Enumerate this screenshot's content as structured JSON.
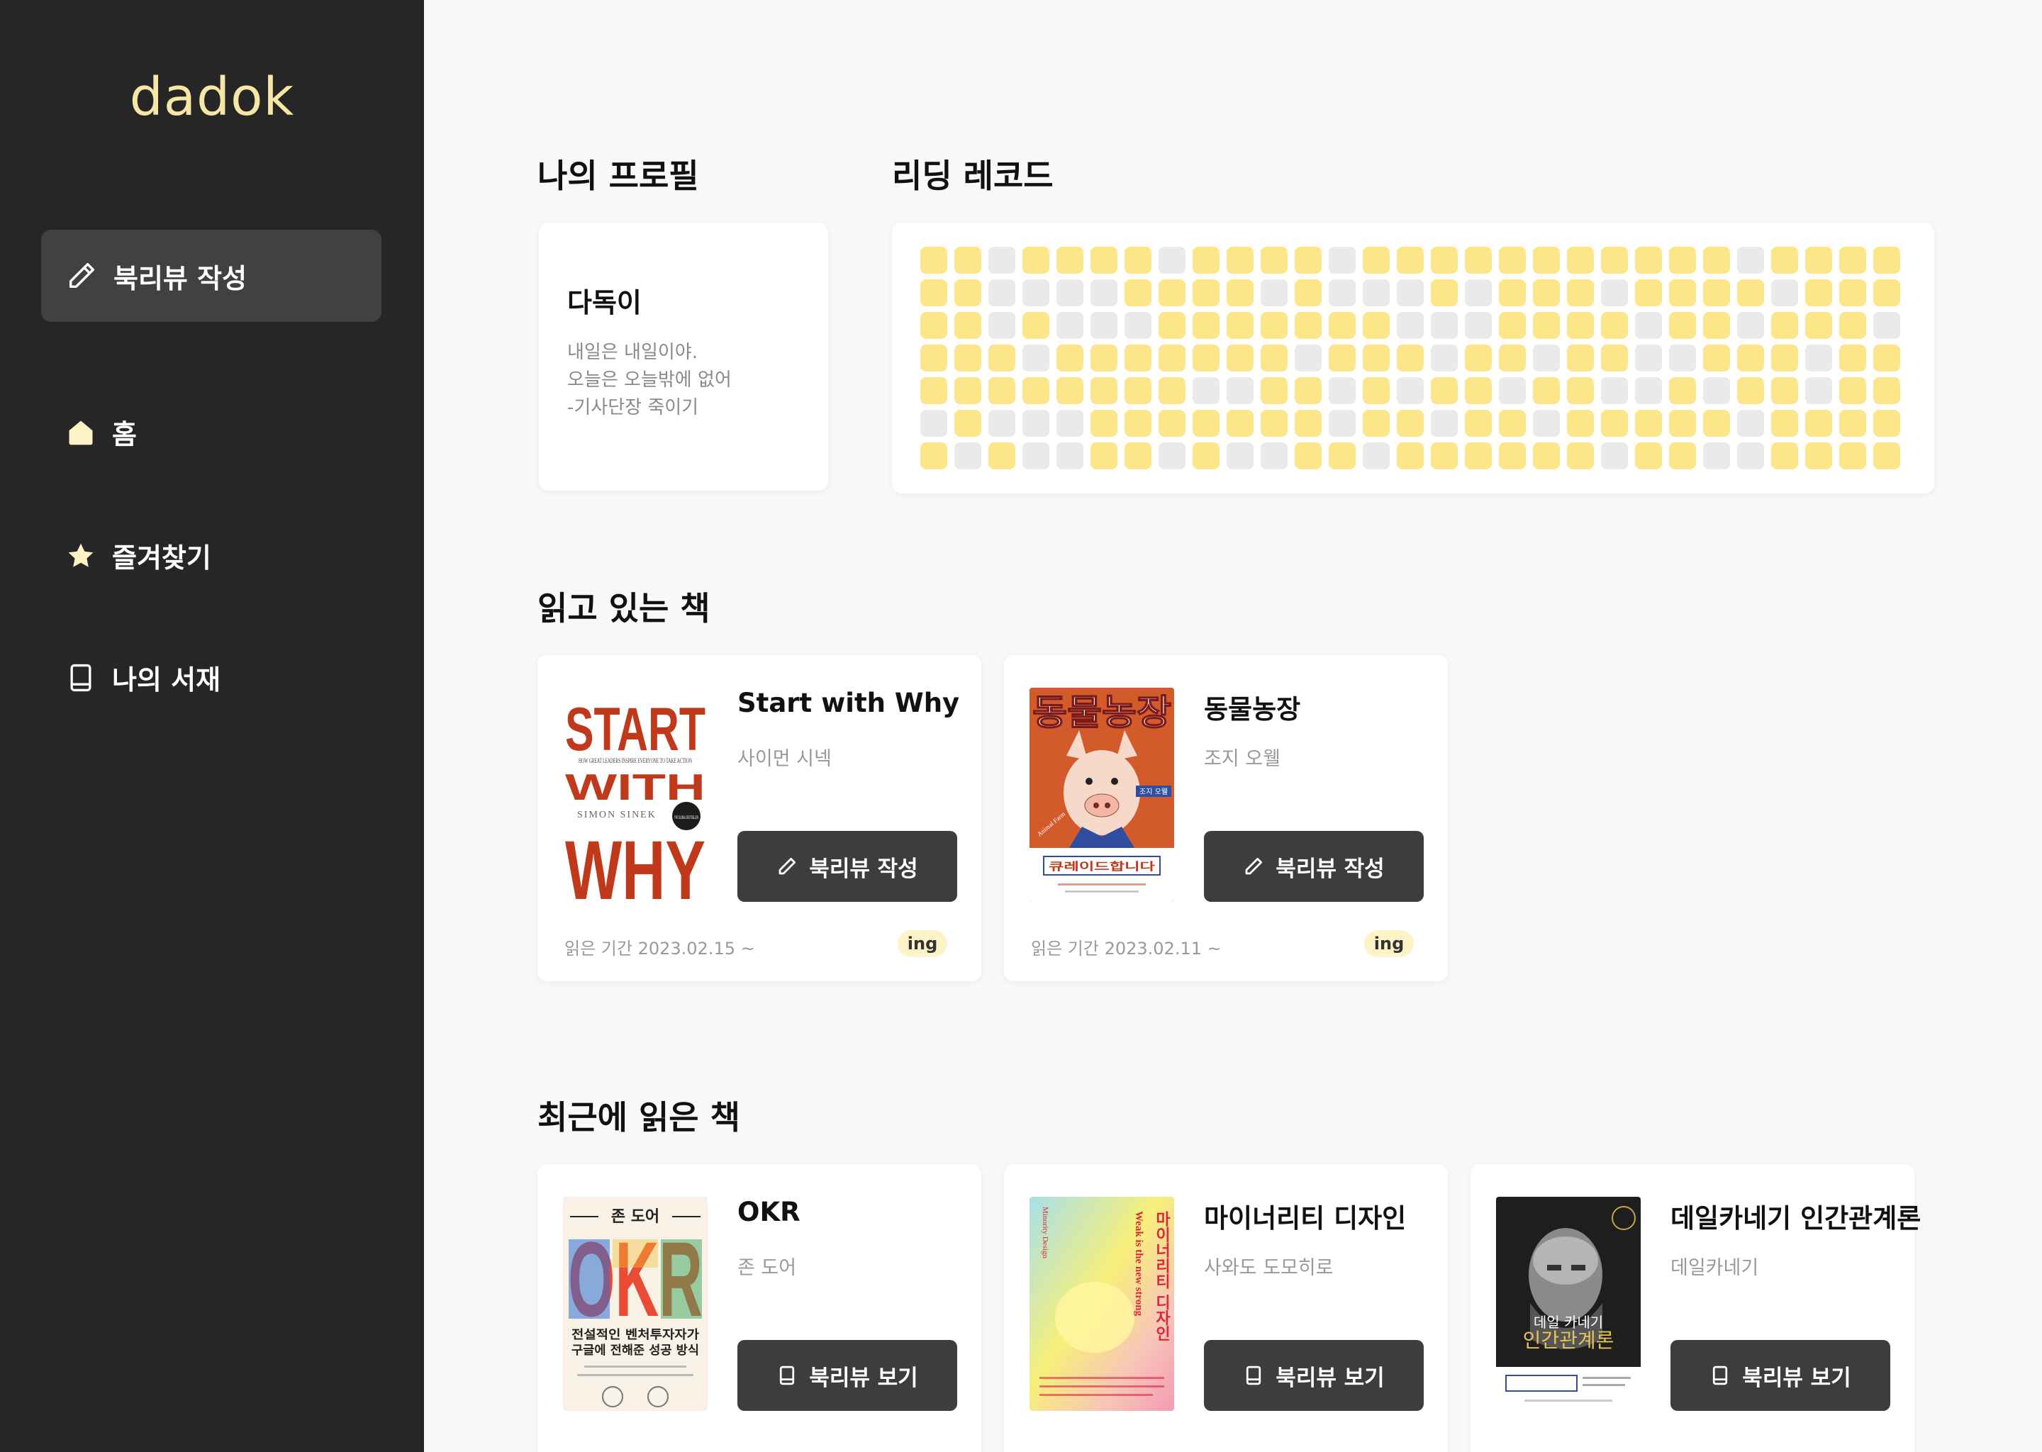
{
  "sidebar": {
    "logo": "dadok",
    "write_button": "북리뷰 작성",
    "nav": [
      {
        "label": "홈",
        "icon": "home-icon"
      },
      {
        "label": "즐겨찾기",
        "icon": "star-icon"
      },
      {
        "label": "나의 서재",
        "icon": "book-icon"
      }
    ]
  },
  "profile": {
    "section_title": "나의 프로필",
    "name": "다독이",
    "bio": [
      "내일은 내일이야.",
      "오늘은 오늘밖에 없어",
      "-기사단장 죽이기"
    ]
  },
  "record": {
    "section_title": "리딩 레코드",
    "rows": [
      "11011110111101111111111101111",
      "11000011110100010111011110111",
      "11010001111111000111101101110",
      "11101111111011101101100111011",
      "11111111001101011011001011011",
      "01000111111101101101111101111",
      "10100110100110111111011001111"
    ]
  },
  "reading": {
    "section_title": "읽고 있는 책",
    "books": [
      {
        "title": "Start with Why",
        "author": "사이먼 시넥",
        "button": "북리뷰 작성",
        "period": "읽은 기간 2023.02.15 ~",
        "status": "ing",
        "cover": {
          "line1": "START",
          "small": "HOW GREAT LEADERS INSPIRE EVERYONE TO TAKE ACTION",
          "line2": "WITH",
          "author": "SIMON SINEK",
          "seal": "THE GLOBAL BESTSELLER",
          "line3": "WHY"
        }
      },
      {
        "title": "동물농장",
        "author": "조지 오웰",
        "button": "북리뷰 작성",
        "period": "읽은 기간 2023.02.11 ~",
        "status": "ing",
        "cover": {
          "title": "동물농장",
          "author_tag": "조지 오웰",
          "side": "Animal Farm",
          "ribbon": "큐레이드합니다"
        }
      }
    ]
  },
  "recent": {
    "section_title": "최근에 읽은 책",
    "books": [
      {
        "title": "OKR",
        "author": "존 도어",
        "button": "북리뷰 보기",
        "cover": {
          "top": "존 도어",
          "big": "OKR",
          "sub1": "전설적인 벤처투자자가",
          "sub2": "구글에 전해준 성공 방식"
        }
      },
      {
        "title": "마이너리티 디자인",
        "author": "사와도 도모히로",
        "button": "북리뷰 보기",
        "cover": {
          "vertical_title": "마이너리티 디자인",
          "vertical_en": "Weak is the new strong",
          "corner": "Minority Design"
        }
      },
      {
        "title": "데일카네기 인간관계론",
        "author": "데일카네기",
        "button": "북리뷰 보기",
        "cover": {
          "name": "데일 카네기",
          "title": "인간관계론"
        }
      }
    ]
  },
  "colors": {
    "sidebar_bg": "#262626",
    "logo": "#f6e7a7",
    "record_on": "#fde68a",
    "record_off": "#eaeaea",
    "button_bg": "#3d3d3d",
    "badge_bg": "#fef3c7"
  }
}
